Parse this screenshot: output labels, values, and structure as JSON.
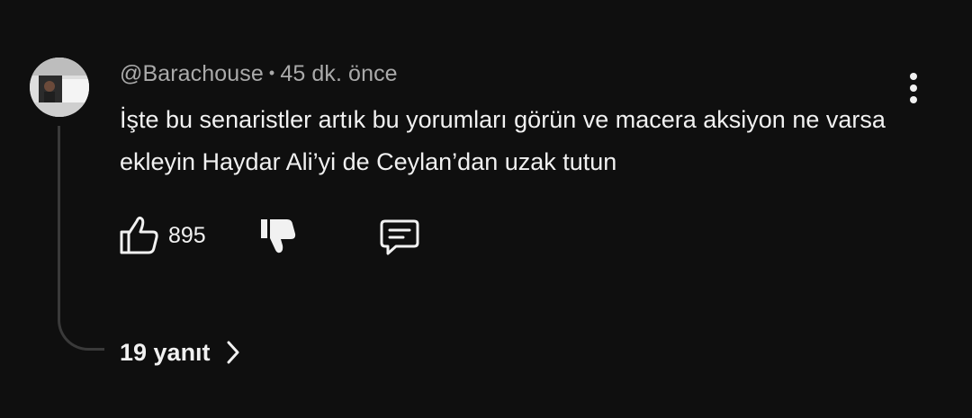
{
  "comment": {
    "author_handle": "@Barachouse",
    "separator": "•",
    "timestamp": "45 dk. önce",
    "text": "İşte bu senaristler artık bu yorumları görün ve macera aksiyon ne varsa ekleyin Haydar Ali’yi de Ceylan’dan uzak tutun",
    "like_count": "895",
    "replies_label": "19 yanıt"
  },
  "icons": {
    "more": "vertical-dots-icon",
    "like": "thumbs-up-icon",
    "dislike": "thumbs-down-icon",
    "reply": "comment-bubble-icon",
    "expand": "chevron-right-icon"
  },
  "colors": {
    "background": "#0f0f0f",
    "primary_text": "#f1f1f1",
    "secondary_text": "#aaaaaa",
    "thread_line": "#3a3a3a"
  }
}
